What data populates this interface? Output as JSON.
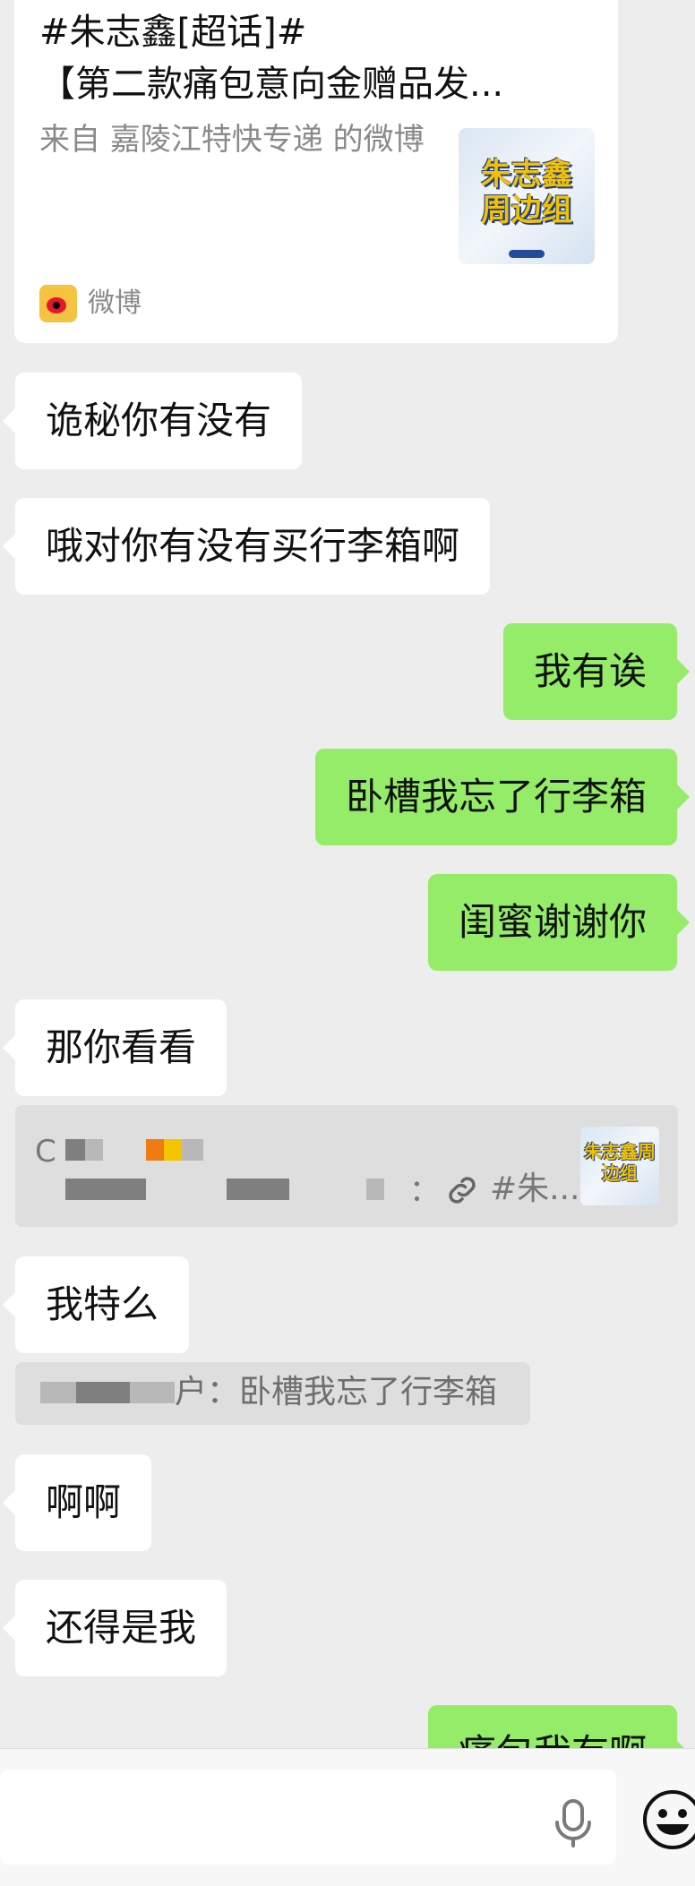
{
  "card": {
    "title_line1": "#朱志鑫[超话]#",
    "title_line2": "【第二款痛包意向金赠品发...",
    "source_line": "来自 嘉陵江特快专递 的微博",
    "thumbnail_text": "朱志鑫周边组",
    "app_name": "微博"
  },
  "messages": [
    {
      "side": "left",
      "text": "诡秘你有没有"
    },
    {
      "side": "left",
      "text": "哦对你有没有买行李箱啊"
    },
    {
      "side": "right",
      "text": "我有诶"
    },
    {
      "side": "right",
      "text": "卧槽我忘了行李箱"
    },
    {
      "side": "right",
      "text": "闺蜜谢谢你"
    },
    {
      "side": "left",
      "text": "那你看看"
    },
    {
      "side": "left",
      "text": "我特么"
    },
    {
      "side": "left",
      "text": "啊啊"
    },
    {
      "side": "left",
      "text": "还得是我"
    },
    {
      "side": "right",
      "text": "痛包我有啊"
    }
  ],
  "quote1": {
    "prefix": "C",
    "suffix": "：",
    "link_text": "#朱...",
    "thumbnail_text": "朱志鑫周边组"
  },
  "quote2": {
    "text": "户：卧槽我忘了行李箱"
  },
  "colors": {
    "background": "#ededed",
    "left_bubble": "#ffffff",
    "right_bubble": "#95ec69"
  }
}
